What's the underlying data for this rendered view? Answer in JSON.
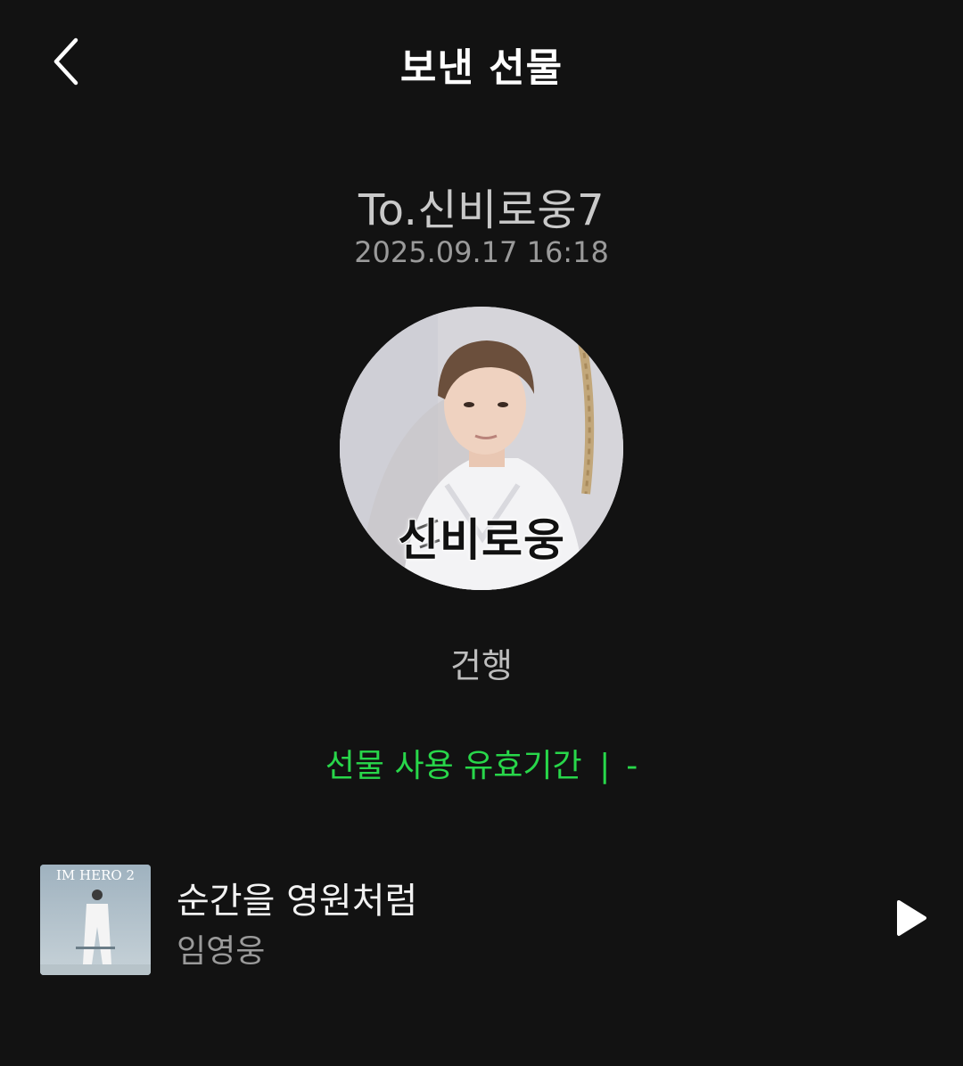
{
  "header": {
    "title": "보낸 선물",
    "back_icon": "chevron-left-icon"
  },
  "gift": {
    "recipient": "To.신비로웅7",
    "datetime": "2025.09.17 16:18",
    "avatar_caption": "신비로웅",
    "message": "건행",
    "validity_label": "선물 사용 유효기간",
    "validity_separator": "|",
    "validity_value": "-"
  },
  "song": {
    "title": "순간을 영원처럼",
    "artist": "임영웅",
    "album_art_text": "IM HERO 2",
    "play_icon": "play-icon"
  },
  "colors": {
    "background": "#121212",
    "accent_green": "#28d74a",
    "title_text": "#ffffff",
    "secondary_text": "#9a9a9a"
  }
}
